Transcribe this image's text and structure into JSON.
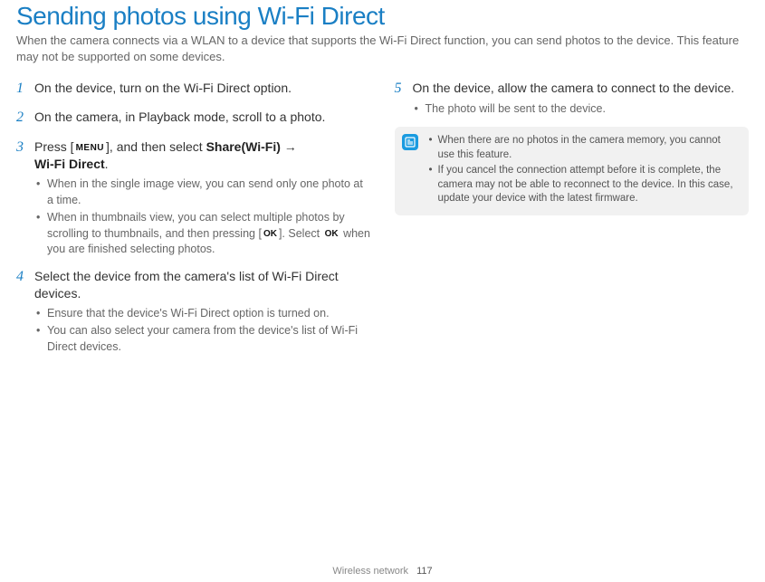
{
  "title": "Sending photos using Wi-Fi Direct",
  "intro": "When the camera connects via a WLAN to a device that supports the Wi-Fi Direct function, you can send photos to the device. This feature may not be supported on some devices.",
  "steps": {
    "s1": {
      "num": "1",
      "text": "On the device, turn on the Wi-Fi Direct option."
    },
    "s2": {
      "num": "2",
      "text": "On the camera, in Playback mode, scroll to a photo."
    },
    "s3": {
      "num": "3",
      "press": "Press [",
      "menu": "MENU",
      "mid": "], and then select ",
      "bold1": "Share(Wi-Fi)",
      "arrow": " → ",
      "bold2": "Wi-Fi Direct",
      "end": ".",
      "bullets": [
        "When in the single image view, you can send only one photo at a time.",
        "When in thumbnails view, you can select multiple photos by scrolling to thumbnails, and then pressing [",
        "]. Select ",
        " when you are finished selecting photos."
      ],
      "ok": "OK"
    },
    "s4": {
      "num": "4",
      "text": "Select the device from the camera's list of Wi-Fi Direct devices.",
      "bullets": [
        "Ensure that the device's Wi-Fi Direct option is turned on.",
        "You can also select your camera from the device's list of Wi-Fi Direct devices."
      ]
    },
    "s5": {
      "num": "5",
      "text": "On the device, allow the camera to connect to the device.",
      "bullets": [
        "The photo will be sent to the device."
      ]
    }
  },
  "notes": [
    "When there are no photos in the camera memory, you cannot use this feature.",
    "If you cancel the connection attempt before it is complete, the camera may not be able to reconnect to the device. In this case, update your device with the latest firmware."
  ],
  "footer": {
    "section": "Wireless network",
    "page": "117"
  }
}
